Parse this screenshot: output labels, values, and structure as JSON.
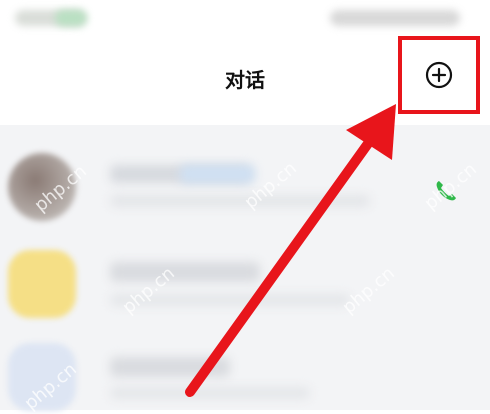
{
  "header": {
    "title": "对话"
  },
  "watermarks": [
    "php.cn",
    "php.cn",
    "php.cn",
    "php.cn",
    "php.cn",
    "php.cn"
  ],
  "colors": {
    "highlight": "#e8151b",
    "call_green": "#2fb84a",
    "list_bg": "#f3f4f6"
  },
  "icons": {
    "add": "plus-circle-icon",
    "call": "phone-icon"
  }
}
